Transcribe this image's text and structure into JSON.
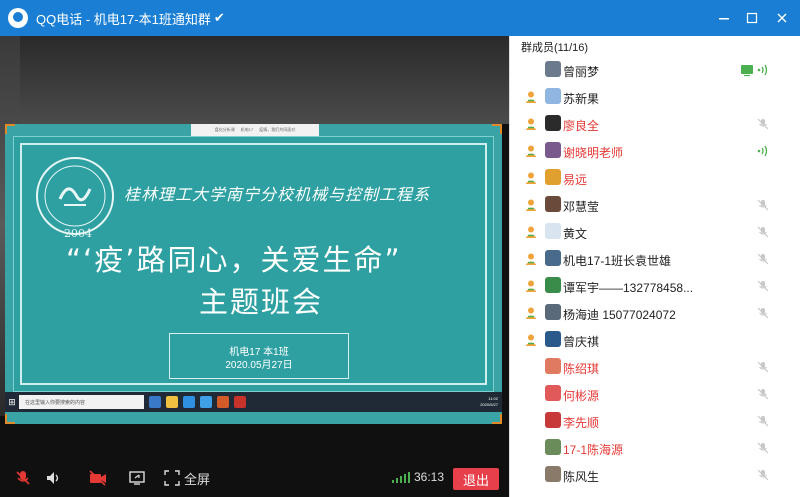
{
  "window": {
    "app_name": "QQ电话",
    "separator": " - ",
    "title": "机电17-本1班通知群",
    "verified_mark": "✔"
  },
  "slide": {
    "mini_tab_1": "盘化分析课",
    "mini_tab_2": "机电17",
    "mini_tab_3": "疫情，我们共同面对",
    "school_name": "桂林理工大学南宁分校机械与控制工程系",
    "logo_glyph": "机",
    "logo_year": "2004",
    "headline_line1": "“‘疫’路同心，关爱生命”",
    "headline_line2": "主题班会",
    "class_label": "机电17   本1班",
    "date": "2020.05月27日",
    "taskbar_search": "在这里输入你要搜索的内容",
    "taskbar_time": "11:02",
    "taskbar_date": "2020/5/27"
  },
  "controls": {
    "mute_mic_icon": "mic-muted-icon",
    "speaker_icon": "speaker-icon",
    "camera_off_icon": "camera-off-icon",
    "share_screen_icon": "share-screen-icon",
    "fullscreen_label": "全屏",
    "signal_icon": "signal-bars-icon",
    "timer": "36:13",
    "exit_label": "退出"
  },
  "panel": {
    "title": "群成员(11/16)",
    "members": [
      {
        "name": "曾丽梦",
        "red": false,
        "online_role": false,
        "screen_share": true,
        "status": "speaking"
      },
      {
        "name": "苏新果",
        "red": false,
        "online_role": true,
        "screen_share": false,
        "status": "none"
      },
      {
        "name": "廖良全",
        "red": true,
        "online_role": true,
        "screen_share": false,
        "status": "muted"
      },
      {
        "name": "谢晓明老师",
        "red": true,
        "online_role": true,
        "screen_share": false,
        "status": "speaking"
      },
      {
        "name": "易远",
        "red": true,
        "online_role": true,
        "screen_share": false,
        "status": "none"
      },
      {
        "name": "邓慧莹",
        "red": false,
        "online_role": true,
        "screen_share": false,
        "status": "muted"
      },
      {
        "name": "黄文",
        "red": false,
        "online_role": true,
        "screen_share": false,
        "status": "muted"
      },
      {
        "name": "机电17-1班长袁世雄",
        "red": false,
        "online_role": true,
        "screen_share": false,
        "status": "muted"
      },
      {
        "name": "谭军宇——13277845​8...",
        "red": false,
        "online_role": true,
        "screen_share": false,
        "status": "muted"
      },
      {
        "name": "杨海迪 15077024072",
        "red": false,
        "online_role": true,
        "screen_share": false,
        "status": "muted"
      },
      {
        "name": "曾庆祺",
        "red": false,
        "online_role": true,
        "screen_share": false,
        "status": "none"
      },
      {
        "name": "陈绍琪",
        "red": true,
        "online_role": false,
        "screen_share": false,
        "status": "muted"
      },
      {
        "name": "何彬源",
        "red": true,
        "online_role": false,
        "screen_share": false,
        "status": "muted"
      },
      {
        "name": "李先顺",
        "red": true,
        "online_role": false,
        "screen_share": false,
        "status": "muted"
      },
      {
        "name": "17-1陈海源",
        "red": true,
        "online_role": false,
        "screen_share": false,
        "status": "muted"
      },
      {
        "name": "陈风生",
        "red": false,
        "online_role": false,
        "screen_share": false,
        "status": "muted"
      }
    ]
  },
  "colors": {
    "titlebar": "#1a7fd4",
    "slide_teal": "#2ea0a2",
    "exit_red": "#e7404a",
    "name_red": "#e53935",
    "speaking_green": "#4caf50"
  }
}
